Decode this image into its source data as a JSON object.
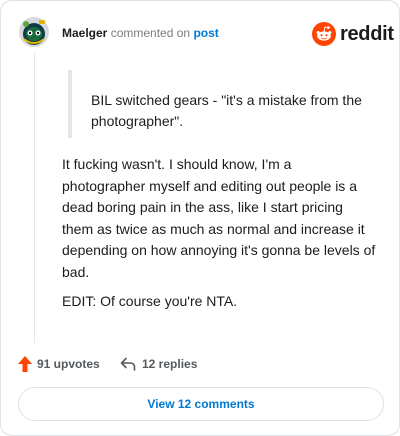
{
  "header": {
    "username": "Maelger",
    "action_text": "commented on",
    "link_text": "post",
    "brand_name": "reddit",
    "brand_color": "#ff4500",
    "avatar_icon": "snoo-avatar-icon",
    "brand_icon": "reddit-logo-icon"
  },
  "comment": {
    "quote": "BIL switched gears - \"it's a mistake from the photographer\".",
    "body": "It fucking wasn't. I should know, I'm a photographer myself and editing out people is a dead boring pain in the ass, like I start pricing them as twice as much as normal and increase it depending on how annoying it's gonna be levels of bad.",
    "edit": "EDIT: Of course you're NTA."
  },
  "footer": {
    "upvotes_label": "91 upvotes",
    "replies_label": "12 replies",
    "view_button_label": "View 12 comments",
    "upvote_icon": "upvote-arrow-icon",
    "reply_icon": "reply-arrow-icon",
    "upvote_color": "#ff4500",
    "link_color": "#0079d3"
  }
}
